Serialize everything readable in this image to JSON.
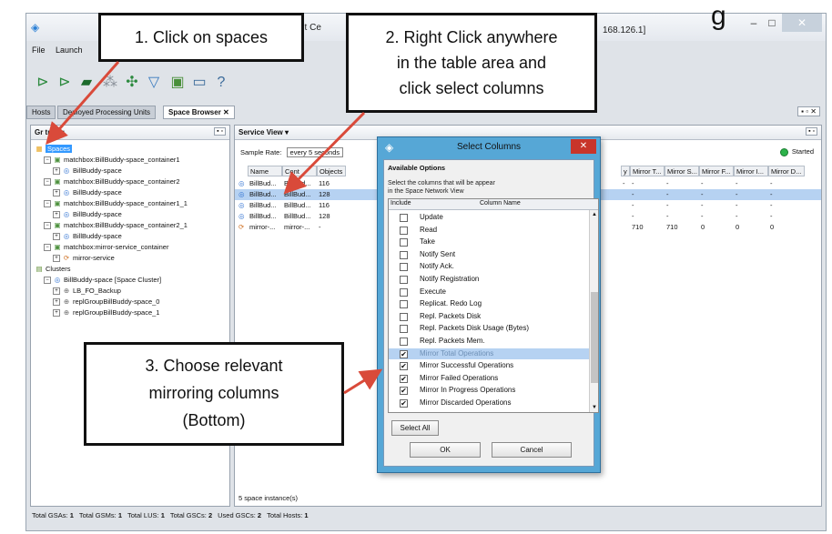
{
  "window": {
    "title_fragment": "nt Ce",
    "ip_fragment": "168.126.1]",
    "heading_fragment": "g"
  },
  "menu": [
    "File",
    "Launch"
  ],
  "toolbar_icons": [
    "deploy-icon",
    "undeploy-icon",
    "book-icon",
    "grid-icon",
    "refresh-icon",
    "filter-icon",
    "layout-icon",
    "window-icon",
    "help-icon"
  ],
  "tabs": [
    {
      "label": "Hosts",
      "active": false
    },
    {
      "label": "Deployed Processing Units",
      "active": false
    },
    {
      "label": "Space Browser",
      "active": true,
      "suffix": "✕"
    }
  ],
  "tabbar_controls": "▪ ▫ ✕",
  "left_panel": {
    "title": "Gr   tree",
    "title_suffix": "▾",
    "controls": "▪ ▫",
    "tree": [
      {
        "label": "Spaces",
        "level": 0,
        "icon": "spaces-icon",
        "selected": true
      },
      {
        "label": "matchbox:BillBuddy-space_container1",
        "level": 1,
        "icon": "container-icon"
      },
      {
        "label": "BillBuddy-space",
        "level": 2,
        "icon": "space-icon"
      },
      {
        "label": "matchbox:BillBuddy-space_container2",
        "level": 1,
        "icon": "container-icon"
      },
      {
        "label": "BillBuddy-space",
        "level": 2,
        "icon": "space-icon"
      },
      {
        "label": "matchbox:BillBuddy-space_container1_1",
        "level": 1,
        "icon": "container-icon"
      },
      {
        "label": "BillBuddy-space",
        "level": 2,
        "icon": "space-icon"
      },
      {
        "label": "matchbox:BillBuddy-space_container2_1",
        "level": 1,
        "icon": "container-icon"
      },
      {
        "label": "BillBuddy-space",
        "level": 2,
        "icon": "space-icon"
      },
      {
        "label": "matchbox:mirror-service_container",
        "level": 1,
        "icon": "container-icon"
      },
      {
        "label": "mirror-service",
        "level": 2,
        "icon": "mirror-icon"
      },
      {
        "label": "Clusters",
        "level": 0,
        "icon": "cluster-icon"
      },
      {
        "label": "BillBuddy-space [Space Cluster]",
        "level": 1,
        "icon": "space-icon"
      },
      {
        "label": "LB_FO_Backup",
        "level": 2,
        "icon": "group-icon"
      },
      {
        "label": "replGroupBillBuddy-space_0",
        "level": 2,
        "icon": "group-icon"
      },
      {
        "label": "replGroupBillBuddy-space_1",
        "level": 2,
        "icon": "group-icon"
      }
    ]
  },
  "right_panel": {
    "title": "Service View",
    "title_suffix": "▾",
    "controls": "▪ ▫",
    "sample_label": "Sample Rate:",
    "sample_value": "every 5 seconds",
    "status": "Started",
    "status_color": "#2cb34a",
    "columns_left": [
      "Name",
      "Cont",
      "Objects"
    ],
    "rows_left": [
      {
        "name": "BillBud...",
        "cont": "BillBud...",
        "objects": "116",
        "selected": false,
        "icon": "space-icon"
      },
      {
        "name": "BillBud...",
        "cont": "BillBud...",
        "objects": "128",
        "selected": true,
        "icon": "space-icon"
      },
      {
        "name": "BillBud...",
        "cont": "BillBud...",
        "objects": "116",
        "selected": false,
        "icon": "space-icon"
      },
      {
        "name": "BillBud...",
        "cont": "BillBud...",
        "objects": "128",
        "selected": false,
        "icon": "space-icon"
      },
      {
        "name": "mirror-...",
        "cont": "mirror-...",
        "objects": "-",
        "selected": false,
        "icon": "mirror-icon"
      }
    ],
    "columns_right": [
      "y",
      "Mirror T...",
      "Mirror S...",
      "Mirror F...",
      "Mirror I...",
      "Mirror D..."
    ],
    "rows_right": [
      [
        "-",
        "-",
        "-",
        "-",
        "-",
        "-"
      ],
      [
        "",
        "-",
        "-",
        "-",
        "-",
        "-"
      ],
      [
        "",
        "-",
        "-",
        "-",
        "-",
        "-"
      ],
      [
        "",
        "-",
        "-",
        "-",
        "-",
        "-"
      ],
      [
        "",
        "710",
        "710",
        "0",
        "0",
        "0"
      ]
    ],
    "status_line": "5 space instance(s)"
  },
  "bottom_status": [
    {
      "label": "Total GSAs:",
      "value": "1"
    },
    {
      "label": "Total GSMs:",
      "value": "1"
    },
    {
      "label": "Total LUS:",
      "value": "1"
    },
    {
      "label": "Total GSCs:",
      "value": "2"
    },
    {
      "label": "Used GSCs:",
      "value": "2"
    },
    {
      "label": "Total Hosts:",
      "value": "1"
    }
  ],
  "dialog": {
    "title": "Select Columns",
    "group": "Available Options",
    "description_1": "Select the columns that will be appear",
    "description_2": "in the Space Network View",
    "col_include": "Include",
    "col_name": "Column Name",
    "options": [
      {
        "label": "Update",
        "checked": false
      },
      {
        "label": "Read",
        "checked": false
      },
      {
        "label": "Take",
        "checked": false
      },
      {
        "label": "Notify Sent",
        "checked": false
      },
      {
        "label": "Notify Ack.",
        "checked": false
      },
      {
        "label": "Notify Registration",
        "checked": false
      },
      {
        "label": "Execute",
        "checked": false
      },
      {
        "label": "Replicat. Redo Log",
        "checked": false
      },
      {
        "label": "Repl. Packets Disk",
        "checked": false
      },
      {
        "label": "Repl. Packets Disk Usage (Bytes)",
        "checked": false
      },
      {
        "label": "Repl. Packets Mem.",
        "checked": false
      },
      {
        "label": "Mirror Total Operations",
        "checked": true,
        "highlighted": true
      },
      {
        "label": "Mirror Successful Operations",
        "checked": true
      },
      {
        "label": "Mirror Failed Operations",
        "checked": true
      },
      {
        "label": "Mirror In Progress Operations",
        "checked": true
      },
      {
        "label": "Mirror Discarded Operations",
        "checked": true
      }
    ],
    "select_all": "Select All",
    "ok": "OK",
    "cancel": "Cancel"
  },
  "callouts": {
    "step1": "1. Click on spaces",
    "step2_line1": "2. Right Click anywhere",
    "step2_line2": "in the table area and",
    "step2_line3": "click select columns",
    "step3_line1": "3. Choose relevant",
    "step3_line2": "mirroring columns",
    "step3_line3": "(Bottom)"
  }
}
